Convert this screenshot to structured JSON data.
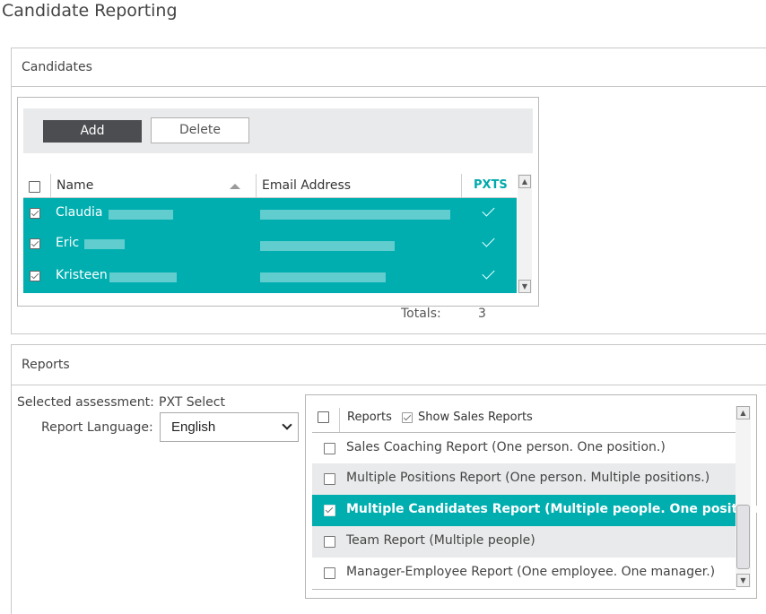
{
  "page": {
    "title": "Candidate Reporting"
  },
  "candidates": {
    "section_title": "Candidates",
    "toolbar": {
      "add_label": "Add",
      "delete_label": "Delete"
    },
    "columns": {
      "name": "Name",
      "email": "Email Address",
      "pxts": "PXTS"
    },
    "rows": [
      {
        "name": "Claudia",
        "email": "[redacted]",
        "checked": true,
        "pxts": true
      },
      {
        "name": "Eric",
        "email": "[redacted]",
        "checked": true,
        "pxts": true
      },
      {
        "name": "Kristeen",
        "email": "[redacted]",
        "checked": true,
        "pxts": true
      }
    ],
    "totals_label": "Totals:",
    "totals_value": "3",
    "colors": {
      "selected_row": "#00aeb0",
      "pxts_header": "#00a9ab",
      "add_button": "#4b4d50"
    }
  },
  "reports": {
    "section_title": "Reports",
    "selected_assessment_label": "Selected assessment:",
    "selected_assessment_value": "PXT Select",
    "language_label": "Report Language:",
    "language_value": "English",
    "list_header": "Reports",
    "show_sales_label": "Show Sales Reports",
    "show_sales_checked": true,
    "items": [
      {
        "label": "Sales Coaching Report (One person. One position.)",
        "checked": false
      },
      {
        "label": "Multiple Positions Report (One person. Multiple positions.)",
        "checked": false
      },
      {
        "label": "Multiple Candidates Report (Multiple people. One position.)",
        "checked": true
      },
      {
        "label": "Team Report (Multiple people)",
        "checked": false
      },
      {
        "label": "Manager-Employee Report (One employee. One manager.)",
        "checked": false
      }
    ]
  }
}
